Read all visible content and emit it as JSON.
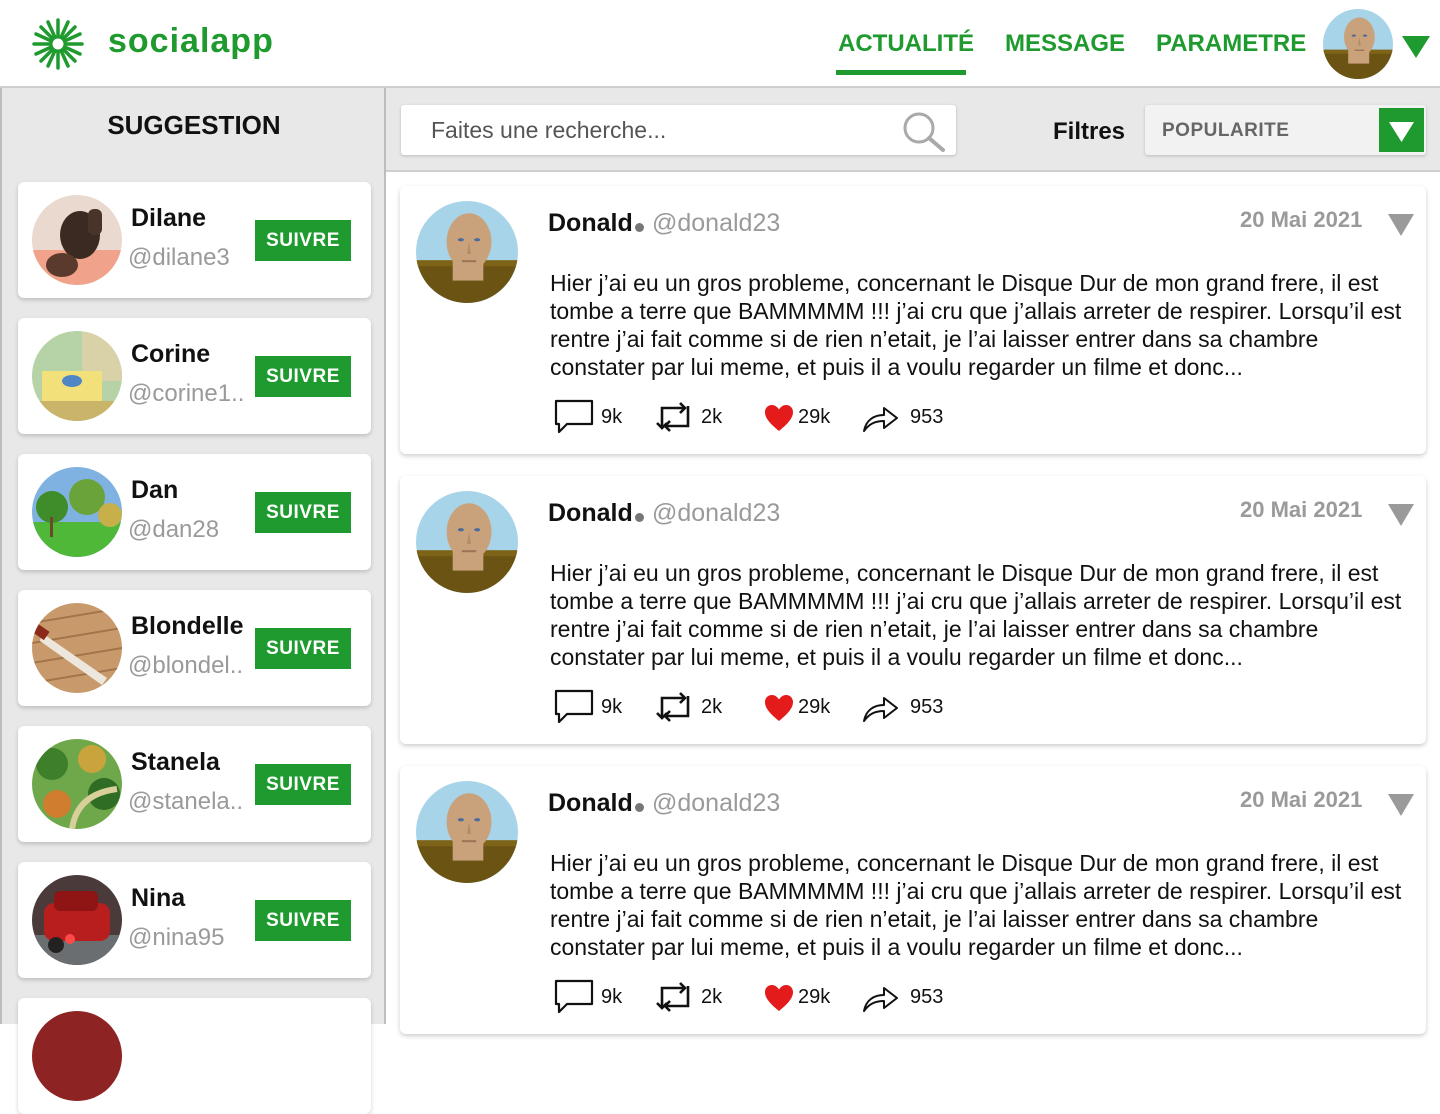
{
  "app": {
    "name": "socialapp",
    "accent_color": "#1e9a2e",
    "logo_icon": "asterisk-burst-icon"
  },
  "header": {
    "nav": [
      {
        "label": "ACTUALITÉ",
        "active": true
      },
      {
        "label": "MESSAGE",
        "active": false
      },
      {
        "label": "PARAMETRE",
        "active": false
      }
    ],
    "user_avatar": "bald-man-3d-avatar",
    "menu_icon": "chevron-down-icon"
  },
  "sidebar": {
    "title": "SUGGESTION",
    "follow_label": "SUIVRE",
    "suggestions": [
      {
        "name": "Dilane",
        "handle": "@dilane3",
        "avatar": "portrait-photo"
      },
      {
        "name": "Corine",
        "handle": "@corine1..",
        "avatar": "kitchen-table-scene"
      },
      {
        "name": "Dan",
        "handle": "@dan28",
        "avatar": "forest-scene"
      },
      {
        "name": "Blondelle",
        "handle": "@blondel..",
        "avatar": "knife-on-wood-scene"
      },
      {
        "name": "Stanela",
        "handle": "@stanela..",
        "avatar": "aerial-forest-scene"
      },
      {
        "name": "Nina",
        "handle": "@nina95",
        "avatar": "red-car-scene"
      }
    ]
  },
  "toolbar": {
    "search_placeholder": "Faites une recherche...",
    "filter_label": "Filtres",
    "filter_value": "POPULARITE"
  },
  "posts": [
    {
      "author": "Donald",
      "handle": "@donald23",
      "date": "20 Mai 2021",
      "body": "Hier j’ai eu un gros probleme, concernant le Disque Dur de mon grand frere, il est tombe a terre que BAMMMMM !!! j’ai cru que j’allais arreter de respirer. Lorsqu’il est rentre j’ai fait comme si de rien n’etait, je l’ai laisser entrer dans sa chambre constater par lui meme, et puis il a voulu regarder un filme et donc...",
      "comments": "9k",
      "retweets": "2k",
      "likes": "29k",
      "shares": "953"
    },
    {
      "author": "Donald",
      "handle": "@donald23",
      "date": "20 Mai 2021",
      "body": "Hier j’ai eu un gros probleme, concernant le Disque Dur de mon grand frere, il est tombe a terre que BAMMMMM !!! j’ai cru que j’allais arreter de respirer. Lorsqu’il est rentre j’ai fait comme si de rien n’etait, je l’ai laisser entrer dans sa chambre constater par lui meme, et puis il a voulu regarder un filme et donc...",
      "comments": "9k",
      "retweets": "2k",
      "likes": "29k",
      "shares": "953"
    },
    {
      "author": "Donald",
      "handle": "@donald23",
      "date": "20 Mai 2021",
      "body": "Hier j’ai eu un gros probleme, concernant le Disque Dur de mon grand frere, il est tombe a terre que BAMMMMM !!! j’ai cru que j’allais arreter de respirer. Lorsqu’il est rentre j’ai fait comme si de rien n’etait, je l’ai laisser entrer dans sa chambre constater par lui meme, et puis il a voulu regarder un filme et donc...",
      "comments": "9k",
      "retweets": "2k",
      "likes": "29k",
      "shares": "953"
    }
  ]
}
